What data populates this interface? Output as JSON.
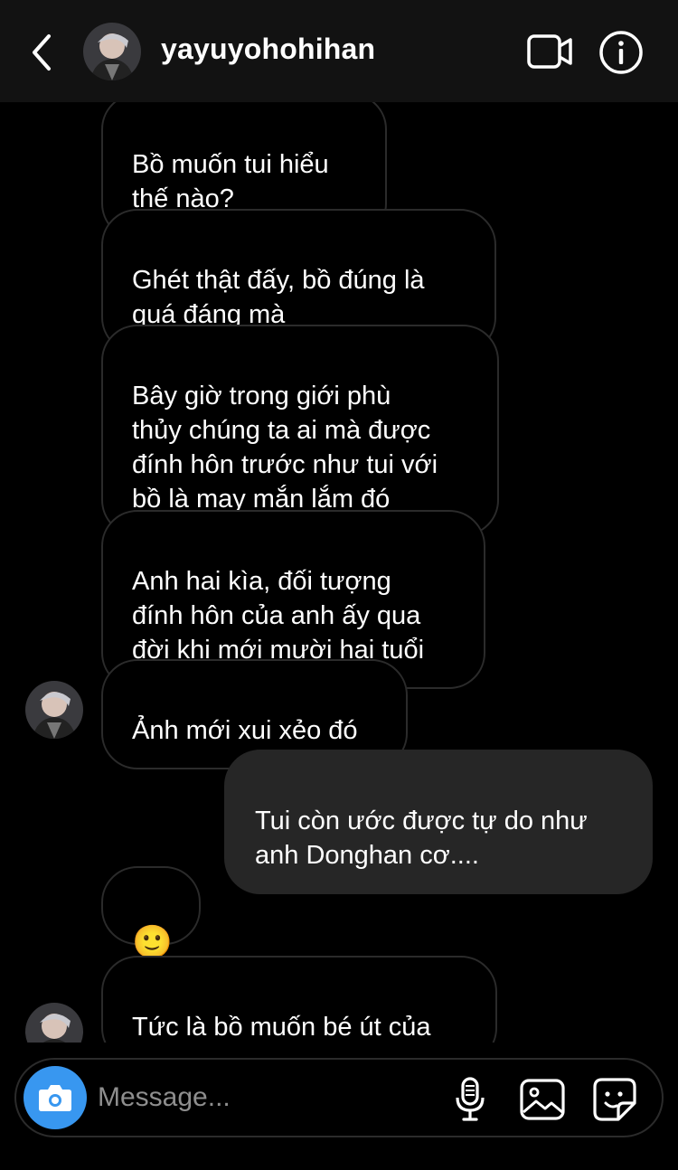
{
  "header": {
    "username": "yayuyohohihan"
  },
  "messages": [
    {
      "direction": "incoming",
      "text": "Bồ muốn tui hiểu\nthế nào?"
    },
    {
      "direction": "incoming",
      "text": "Ghét thật đấy, bồ đúng là\nquá đáng mà"
    },
    {
      "direction": "incoming",
      "text": "Bây giờ trong giới phù\nthủy chúng ta ai mà được\nđính hôn trước như tui với\nbồ là may mắn lắm đó"
    },
    {
      "direction": "incoming",
      "text": "Anh hai kìa, đối tượng\nđính hôn của anh ấy qua\nđời khi mới mười hai tuổi"
    },
    {
      "direction": "incoming",
      "text": "Ảnh mới xui xẻo đó"
    },
    {
      "direction": "outgoing",
      "text": "Tui còn ước được tự do như\nanh Donghan cơ...."
    },
    {
      "direction": "incoming",
      "text": "🙂"
    },
    {
      "direction": "incoming",
      "text": "Tức là bồ muốn bé út của\ntui chết sớm?"
    }
  ],
  "composer": {
    "placeholder": "Message..."
  },
  "colors": {
    "header_bg": "#121212",
    "incoming_border": "#2b2b2b",
    "outgoing_bg": "#262626",
    "camera_button": "#3897f0",
    "placeholder": "#8e8e8e"
  },
  "icons": {
    "back": "chevron-left-icon",
    "video": "video-camera-icon",
    "info": "info-icon",
    "camera": "camera-icon",
    "mic": "microphone-icon",
    "gallery": "image-icon",
    "sticker": "sticker-icon"
  }
}
